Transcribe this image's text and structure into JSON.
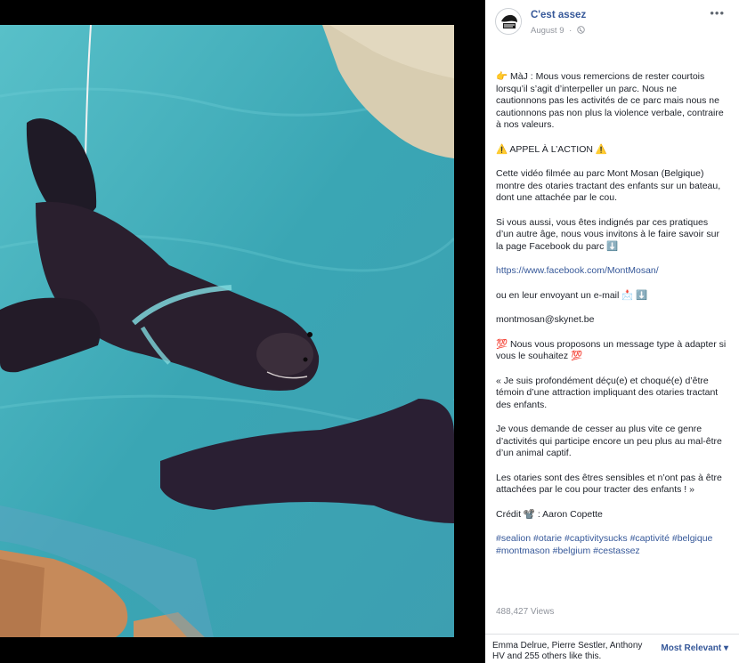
{
  "post": {
    "page_name": "C'est assez",
    "date": "August 9",
    "separator": "·",
    "privacy_icon": "globe-icon",
    "more_icon": "ellipsis-icon",
    "paragraphs": [
      "👉 MàJ : Mous vous remercions de rester courtois lorsqu’il s’agit d’interpeller un parc. Nous ne cautionnons pas les activités de ce parc mais nous ne cautionnons pas non plus la violence verbale, contraire à nos valeurs.",
      "⚠️ APPEL À L’ACTION ⚠️",
      "Cette vidéo filmée au parc Mont Mosan (Belgique) montre des otaries tractant des enfants sur un bateau, dont une attachée par le cou.",
      "Si vous aussi, vous êtes indignés par ces pratiques d’un autre âge, nous vous invitons à le faire savoir sur la page Facebook du parc ⬇️",
      "https://www.facebook.com/MontMosan/",
      "ou en leur envoyant un e-mail 📩 ⬇️",
      "montmosan@skynet.be",
      "💯 Nous vous proposons un message type à adapter si vous le souhaitez 💯",
      "« Je suis profondément déçu(e) et choqué(e) d’être témoin d’une attraction impliquant des otaries tractant des enfants.",
      "Je vous demande de cesser au plus vite ce genre d’activités qui participe encore un peu plus au mal-être d’un animal captif.",
      "Les otaries sont des êtres sensibles et n’ont pas à être attachées par le cou pour tracter des enfants ! »",
      "Crédit 📽️ : Aaron Copette",
      "#sealion #otarie #captivitysucks #captivité #belgique #montmason #belgium #cestassez"
    ],
    "views": "488,427 Views",
    "likes": "Emma Delrue, Pierre Sestler, Anthony HV and 255 others like this.",
    "sort_label": "Most Relevant ▾"
  },
  "colors": {
    "link": "#365899",
    "water": "#43aeba",
    "seal": "#2a1f2e"
  }
}
